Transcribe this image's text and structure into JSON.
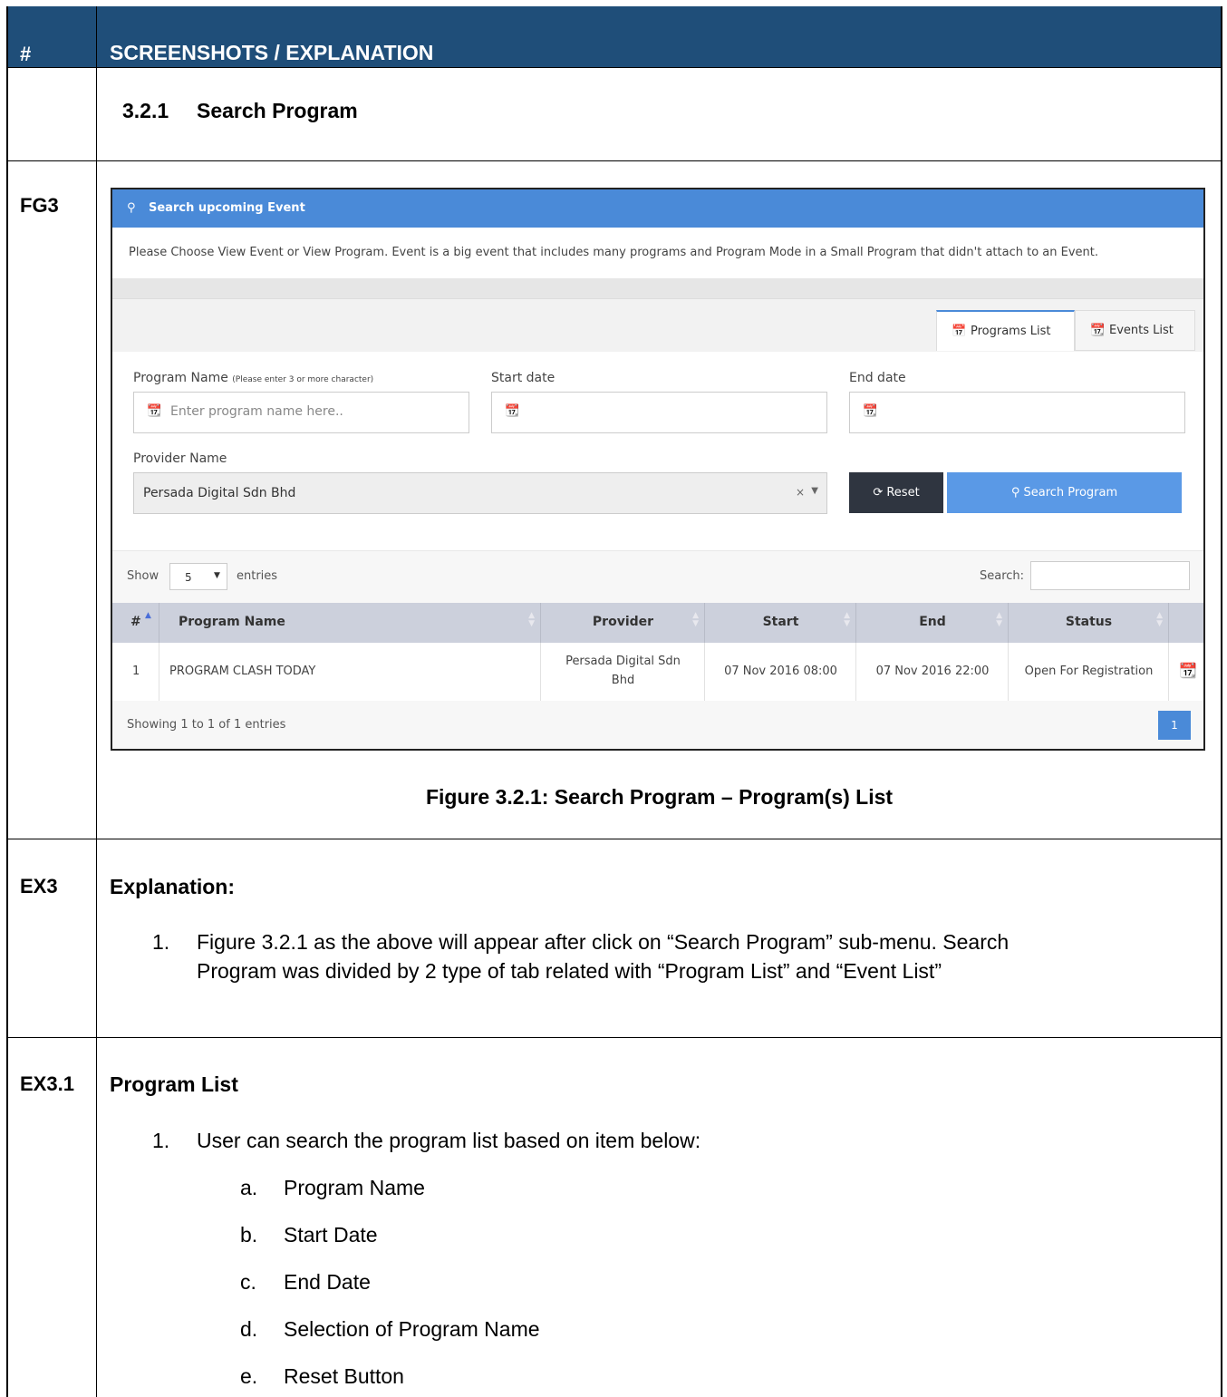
{
  "header": {
    "hash": "#",
    "title": "SCREENSHOTS / EXPLANATION"
  },
  "section": {
    "number": "3.2.1",
    "title": "Search Program"
  },
  "rows": {
    "fg": "FG3",
    "ex": "EX3",
    "ex31": "EX3.1"
  },
  "screenshot": {
    "panel_title": "Search upcoming Event",
    "notice": "Please Choose View Event or View Program. Event is a big event that includes many programs and Program Mode in a Small Program that didn't attach to an Event.",
    "tabs": [
      {
        "label": "Programs List",
        "active": true
      },
      {
        "label": "Events List",
        "active": false
      }
    ],
    "program_name_label": "Program Name",
    "program_name_hint": "(Please enter 3 or more character)",
    "program_name_placeholder": "Enter program name here..",
    "start_date_label": "Start date",
    "end_date_label": "End date",
    "provider_label": "Provider Name",
    "provider_value": "Persada Digital Sdn Bhd",
    "reset_label": "Reset",
    "search_label": "Search Program",
    "show_label": "Show",
    "entries_value": "5",
    "entries_label": "entries",
    "search_box_label": "Search:",
    "columns": [
      "#",
      "Program Name",
      "Provider",
      "Start",
      "End",
      "Status"
    ],
    "row": {
      "no": "1",
      "name": "PROGRAM CLASH TODAY",
      "provider_l1": "Persada Digital Sdn",
      "provider_l2": "Bhd",
      "start": "07 Nov 2016 08:00",
      "end": "07 Nov 2016 22:00",
      "status": "Open For Registration"
    },
    "showing": "Showing 1 to 1 of 1 entries",
    "page": "1",
    "colors": {
      "primary": "#4a8ad8",
      "reset": "#2f3540",
      "header_bar": "#1f4e79"
    }
  },
  "caption": "Figure 3.2.1: Search Program – Program(s) List",
  "explanation": {
    "title": "Explanation:",
    "item_num": "1.",
    "line1": "Figure 3.2.1 as the above will appear after click on “Search Program” sub-menu. Search",
    "line2": "Program was divided by 2 type of tab related with “Program List” and “Event List”"
  },
  "program_list": {
    "title": "Program List",
    "item_num": "1.",
    "intro": "User can search the program list based on item below:",
    "items": [
      {
        "letter": "a.",
        "text": "Program Name"
      },
      {
        "letter": "b.",
        "text": "Start Date"
      },
      {
        "letter": "c.",
        "text": "End Date"
      },
      {
        "letter": "d.",
        "text": "Selection of Program Name"
      },
      {
        "letter": "e.",
        "text": "Reset Button"
      }
    ]
  }
}
